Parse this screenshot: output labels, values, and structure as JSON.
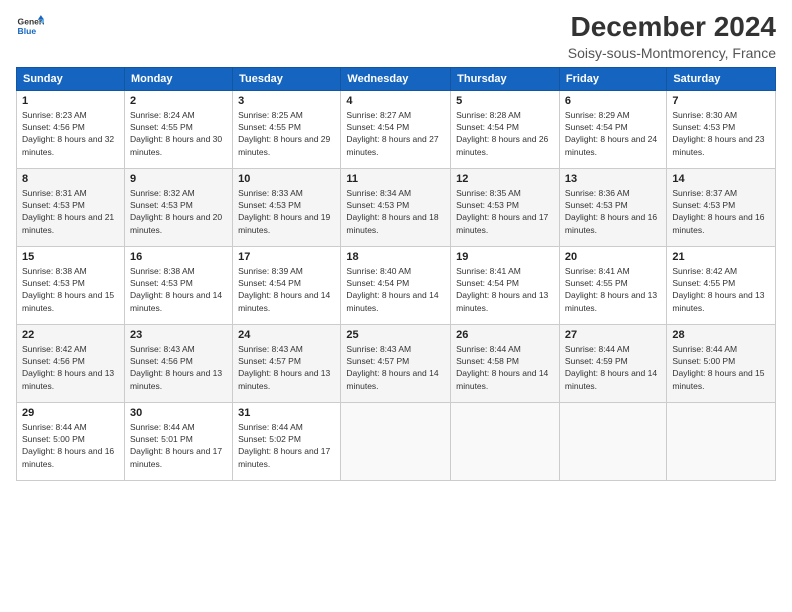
{
  "logo": {
    "line1": "General",
    "line2": "Blue"
  },
  "header": {
    "month": "December 2024",
    "location": "Soisy-sous-Montmorency, France"
  },
  "weekdays": [
    "Sunday",
    "Monday",
    "Tuesday",
    "Wednesday",
    "Thursday",
    "Friday",
    "Saturday"
  ],
  "weeks": [
    [
      {
        "day": "1",
        "sunrise": "8:23 AM",
        "sunset": "4:56 PM",
        "daylight": "8 hours and 32 minutes."
      },
      {
        "day": "2",
        "sunrise": "8:24 AM",
        "sunset": "4:55 PM",
        "daylight": "8 hours and 30 minutes."
      },
      {
        "day": "3",
        "sunrise": "8:25 AM",
        "sunset": "4:55 PM",
        "daylight": "8 hours and 29 minutes."
      },
      {
        "day": "4",
        "sunrise": "8:27 AM",
        "sunset": "4:54 PM",
        "daylight": "8 hours and 27 minutes."
      },
      {
        "day": "5",
        "sunrise": "8:28 AM",
        "sunset": "4:54 PM",
        "daylight": "8 hours and 26 minutes."
      },
      {
        "day": "6",
        "sunrise": "8:29 AM",
        "sunset": "4:54 PM",
        "daylight": "8 hours and 24 minutes."
      },
      {
        "day": "7",
        "sunrise": "8:30 AM",
        "sunset": "4:53 PM",
        "daylight": "8 hours and 23 minutes."
      }
    ],
    [
      {
        "day": "8",
        "sunrise": "8:31 AM",
        "sunset": "4:53 PM",
        "daylight": "8 hours and 21 minutes."
      },
      {
        "day": "9",
        "sunrise": "8:32 AM",
        "sunset": "4:53 PM",
        "daylight": "8 hours and 20 minutes."
      },
      {
        "day": "10",
        "sunrise": "8:33 AM",
        "sunset": "4:53 PM",
        "daylight": "8 hours and 19 minutes."
      },
      {
        "day": "11",
        "sunrise": "8:34 AM",
        "sunset": "4:53 PM",
        "daylight": "8 hours and 18 minutes."
      },
      {
        "day": "12",
        "sunrise": "8:35 AM",
        "sunset": "4:53 PM",
        "daylight": "8 hours and 17 minutes."
      },
      {
        "day": "13",
        "sunrise": "8:36 AM",
        "sunset": "4:53 PM",
        "daylight": "8 hours and 16 minutes."
      },
      {
        "day": "14",
        "sunrise": "8:37 AM",
        "sunset": "4:53 PM",
        "daylight": "8 hours and 16 minutes."
      }
    ],
    [
      {
        "day": "15",
        "sunrise": "8:38 AM",
        "sunset": "4:53 PM",
        "daylight": "8 hours and 15 minutes."
      },
      {
        "day": "16",
        "sunrise": "8:38 AM",
        "sunset": "4:53 PM",
        "daylight": "8 hours and 14 minutes."
      },
      {
        "day": "17",
        "sunrise": "8:39 AM",
        "sunset": "4:54 PM",
        "daylight": "8 hours and 14 minutes."
      },
      {
        "day": "18",
        "sunrise": "8:40 AM",
        "sunset": "4:54 PM",
        "daylight": "8 hours and 14 minutes."
      },
      {
        "day": "19",
        "sunrise": "8:41 AM",
        "sunset": "4:54 PM",
        "daylight": "8 hours and 13 minutes."
      },
      {
        "day": "20",
        "sunrise": "8:41 AM",
        "sunset": "4:55 PM",
        "daylight": "8 hours and 13 minutes."
      },
      {
        "day": "21",
        "sunrise": "8:42 AM",
        "sunset": "4:55 PM",
        "daylight": "8 hours and 13 minutes."
      }
    ],
    [
      {
        "day": "22",
        "sunrise": "8:42 AM",
        "sunset": "4:56 PM",
        "daylight": "8 hours and 13 minutes."
      },
      {
        "day": "23",
        "sunrise": "8:43 AM",
        "sunset": "4:56 PM",
        "daylight": "8 hours and 13 minutes."
      },
      {
        "day": "24",
        "sunrise": "8:43 AM",
        "sunset": "4:57 PM",
        "daylight": "8 hours and 13 minutes."
      },
      {
        "day": "25",
        "sunrise": "8:43 AM",
        "sunset": "4:57 PM",
        "daylight": "8 hours and 14 minutes."
      },
      {
        "day": "26",
        "sunrise": "8:44 AM",
        "sunset": "4:58 PM",
        "daylight": "8 hours and 14 minutes."
      },
      {
        "day": "27",
        "sunrise": "8:44 AM",
        "sunset": "4:59 PM",
        "daylight": "8 hours and 14 minutes."
      },
      {
        "day": "28",
        "sunrise": "8:44 AM",
        "sunset": "5:00 PM",
        "daylight": "8 hours and 15 minutes."
      }
    ],
    [
      {
        "day": "29",
        "sunrise": "8:44 AM",
        "sunset": "5:00 PM",
        "daylight": "8 hours and 16 minutes."
      },
      {
        "day": "30",
        "sunrise": "8:44 AM",
        "sunset": "5:01 PM",
        "daylight": "8 hours and 17 minutes."
      },
      {
        "day": "31",
        "sunrise": "8:44 AM",
        "sunset": "5:02 PM",
        "daylight": "8 hours and 17 minutes."
      },
      null,
      null,
      null,
      null
    ]
  ],
  "labels": {
    "sunrise": "Sunrise:",
    "sunset": "Sunset:",
    "daylight": "Daylight:"
  }
}
